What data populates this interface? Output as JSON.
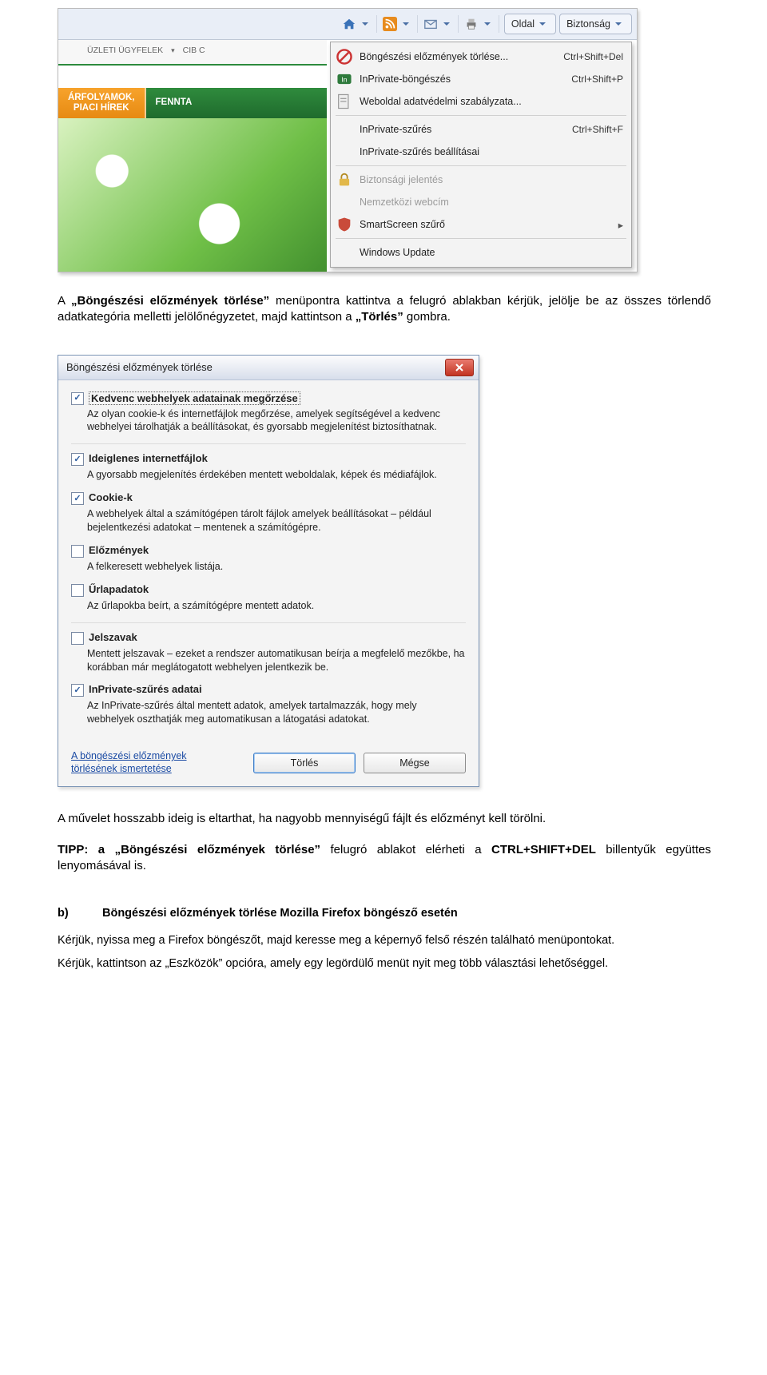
{
  "toolbar": {
    "page_btn": "Oldal",
    "security_btn": "Biztonság"
  },
  "webpage": {
    "nav_item1": "ÜZLETI ÜGYFELEK",
    "nav_item2": "CIB C",
    "tab_orange_l1": "ÁRFOLYAMOK,",
    "tab_orange_l2": "PIACI HÍREK",
    "tab_green": "FENNTA"
  },
  "menu": {
    "i1": {
      "label": "Böngészési előzmények törlése...",
      "short": "Ctrl+Shift+Del"
    },
    "i2": {
      "label": "InPrivate-böngészés",
      "short": "Ctrl+Shift+P"
    },
    "i3": {
      "label": "Weboldal adatvédelmi szabályzata..."
    },
    "i4": {
      "label": "InPrivate-szűrés",
      "short": "Ctrl+Shift+F"
    },
    "i5": {
      "label": "InPrivate-szűrés beállításai"
    },
    "i6": {
      "label": "Biztonsági jelentés"
    },
    "i7": {
      "label": "Nemzetközi webcím"
    },
    "i8": {
      "label": "SmartScreen szűrő"
    },
    "i9": {
      "label": "Windows Update"
    }
  },
  "para1": {
    "pre": "A ",
    "b1": "„Böngészési előzmények törlése”",
    "mid": " menüpontra kattintva a felugró ablakban kérjük, jelölje be az összes törlendő adatkategória melletti jelölőnégyzetet, majd kattintson a ",
    "b2": "„Törlés”",
    "post": " gombra."
  },
  "dialog": {
    "title": "Böngészési előzmények törlése",
    "groups": [
      {
        "checked": true,
        "focus": true,
        "label": "Kedvenc webhelyek adatainak megőrzése",
        "desc": "Az olyan cookie-k és internetfájlok megőrzése, amelyek segítségével a kedvenc webhelyei tárolhatják a beállításokat, és gyorsabb megjelenítést biztosíthatnak."
      },
      {
        "checked": true,
        "label": "Ideiglenes internetfájlok",
        "desc": "A gyorsabb megjelenítés érdekében mentett weboldalak, képek és médiafájlok."
      },
      {
        "checked": true,
        "label": "Cookie-k",
        "desc": "A webhelyek által a számítógépen tárolt fájlok amelyek beállításokat – például bejelentkezési adatokat – mentenek a számítógépre."
      },
      {
        "checked": false,
        "label": "Előzmények",
        "desc": "A felkeresett webhelyek listája."
      },
      {
        "checked": false,
        "label": "Űrlapadatok",
        "desc": "Az űrlapokba beírt, a számítógépre mentett adatok."
      },
      {
        "checked": false,
        "label": "Jelszavak",
        "desc": "Mentett jelszavak – ezeket a rendszer automatikusan beírja a megfelelő mezőkbe, ha korábban már meglátogatott webhelyen jelentkezik be."
      },
      {
        "checked": true,
        "label": "InPrivate-szűrés adatai",
        "desc": "Az InPrivate-szűrés által mentett adatok, amelyek tartalmazzák, hogy mely webhelyek oszthatják meg automatikusan a látogatási adatokat."
      }
    ],
    "about_l1": "A böngészési előzmények",
    "about_l2": "törlésének ismertetése",
    "btn_delete": "Törlés",
    "btn_cancel": "Mégse"
  },
  "para2": "A művelet hosszabb ideig is eltarthat, ha nagyobb mennyiségű fájlt és előzményt kell törölni.",
  "tip": {
    "pre": "TIPP: a ",
    "b1": "„Böngészési előzmények törlése”",
    "mid": " felugró ablakot elérheti a ",
    "b2": "CTRL+SHIFT+DEL",
    "post": " billentyűk együttes lenyomásával is."
  },
  "sectionB": {
    "letter": "b)",
    "title": "Böngészési előzmények törlése Mozilla Firefox böngésző esetén",
    "p1_pre": "Kérjük, nyissa meg a ",
    "p1_b": "Firefox",
    "p1_post": " böngészőt, majd keresse meg a képernyő felső részén található menüpontokat.",
    "p2_pre": "Kérjük, kattintson az ",
    "p2_b": "„Eszközök”",
    "p2_post": " opcióra, amely egy legördülő menüt nyit meg több választási lehetőséggel."
  }
}
